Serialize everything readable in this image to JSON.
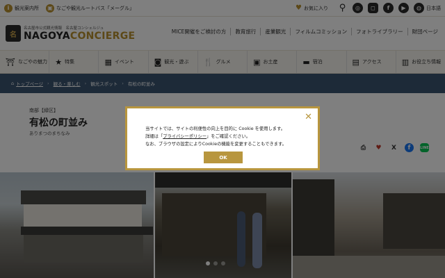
{
  "topbar": {
    "tourist_info": "観光案内所",
    "route_bus": "なごや観光ルートバス「メーグル」",
    "favorites": "お気に入り",
    "language": "日本語"
  },
  "header": {
    "logo_sub": "名古屋市公式観光情報　名古屋コンシェルジュ",
    "logo_main_a": "NAGOYA",
    "logo_main_b": "CONCIERGE",
    "nav": [
      "MICE開催をご検討の方",
      "教育旅行",
      "産業観光",
      "フィルムコミッション",
      "フォトライブラリー",
      "財団ページ"
    ]
  },
  "categories": [
    {
      "label": "なごやの魅力",
      "icon": "castle-icon"
    },
    {
      "label": "特集",
      "icon": "star-icon"
    },
    {
      "label": "イベント",
      "icon": "calendar-icon"
    },
    {
      "label": "観光・遊ぶ",
      "icon": "camera-icon"
    },
    {
      "label": "グルメ",
      "icon": "fork-knife-icon"
    },
    {
      "label": "お土産",
      "icon": "gift-icon"
    },
    {
      "label": "宿泊",
      "icon": "bed-icon"
    },
    {
      "label": "アクセス",
      "icon": "train-icon"
    },
    {
      "label": "お役立ち情報",
      "icon": "book-icon"
    }
  ],
  "breadcrumb": [
    "トップページ",
    "観る・楽しむ",
    "観光スポット",
    "有松の町並み"
  ],
  "spot": {
    "area": "南部【緑区】",
    "title": "有松の町並み",
    "reading": "ありまつのまちなみ"
  },
  "share": {
    "line_label": "LINE"
  },
  "cookie": {
    "line1": "当サイトでは、サイトの利便性の向上を目的に Cookie を使用します。",
    "line2_a": "詳細は「",
    "line2_link": "プライバシーポリシー",
    "line2_b": "」をご確認ください。",
    "line3": "なお、ブラウザの設定によりCookieの機能を変更することもできます。",
    "ok_label": "OK"
  },
  "colors": {
    "accent": "#b8963e",
    "breadcrumb_bg": "#3b5470"
  }
}
